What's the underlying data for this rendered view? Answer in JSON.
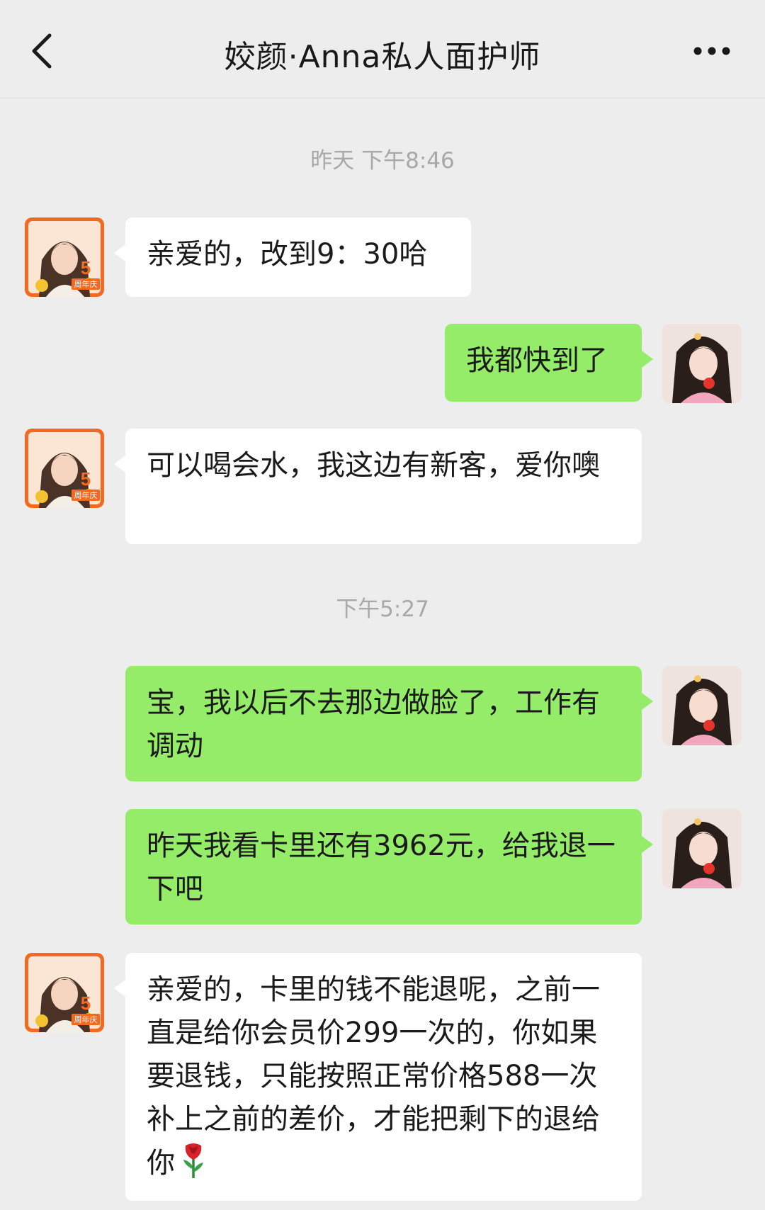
{
  "header": {
    "title": "姣颜·Anna私人面护师",
    "back_icon": "chevron-left-icon",
    "more_icon": "more-dots-icon"
  },
  "timestamps": [
    "昨天 下午8:46",
    "下午5:27"
  ],
  "messages": [
    {
      "side": "left",
      "text": "亲爱的，改到9：30哈"
    },
    {
      "side": "right",
      "text": "我都快到了"
    },
    {
      "side": "left",
      "text": "可以喝会水，我这边有新客，爱你噢"
    },
    {
      "side": "right",
      "text": "宝，我以后不去那边做脸了，工作有调动"
    },
    {
      "side": "right",
      "text": "昨天我看卡里还有3962元，给我退一下吧"
    },
    {
      "side": "left",
      "text": "亲爱的，卡里的钱不能退呢，之前一直是给你会员价299一次的，你如果要退钱，只能按照正常价格588一次补上之前的差价，才能把剩下的退给你",
      "emoji": "rose-icon"
    }
  ],
  "avatar_badge": {
    "number": "5",
    "label": "周年庆"
  },
  "colors": {
    "background": "#EDEDED",
    "bubble_self": "#95EC69",
    "bubble_other": "#FFFFFF",
    "timestamp": "#A8A8A8",
    "avatar_orange": "#F26A21"
  }
}
